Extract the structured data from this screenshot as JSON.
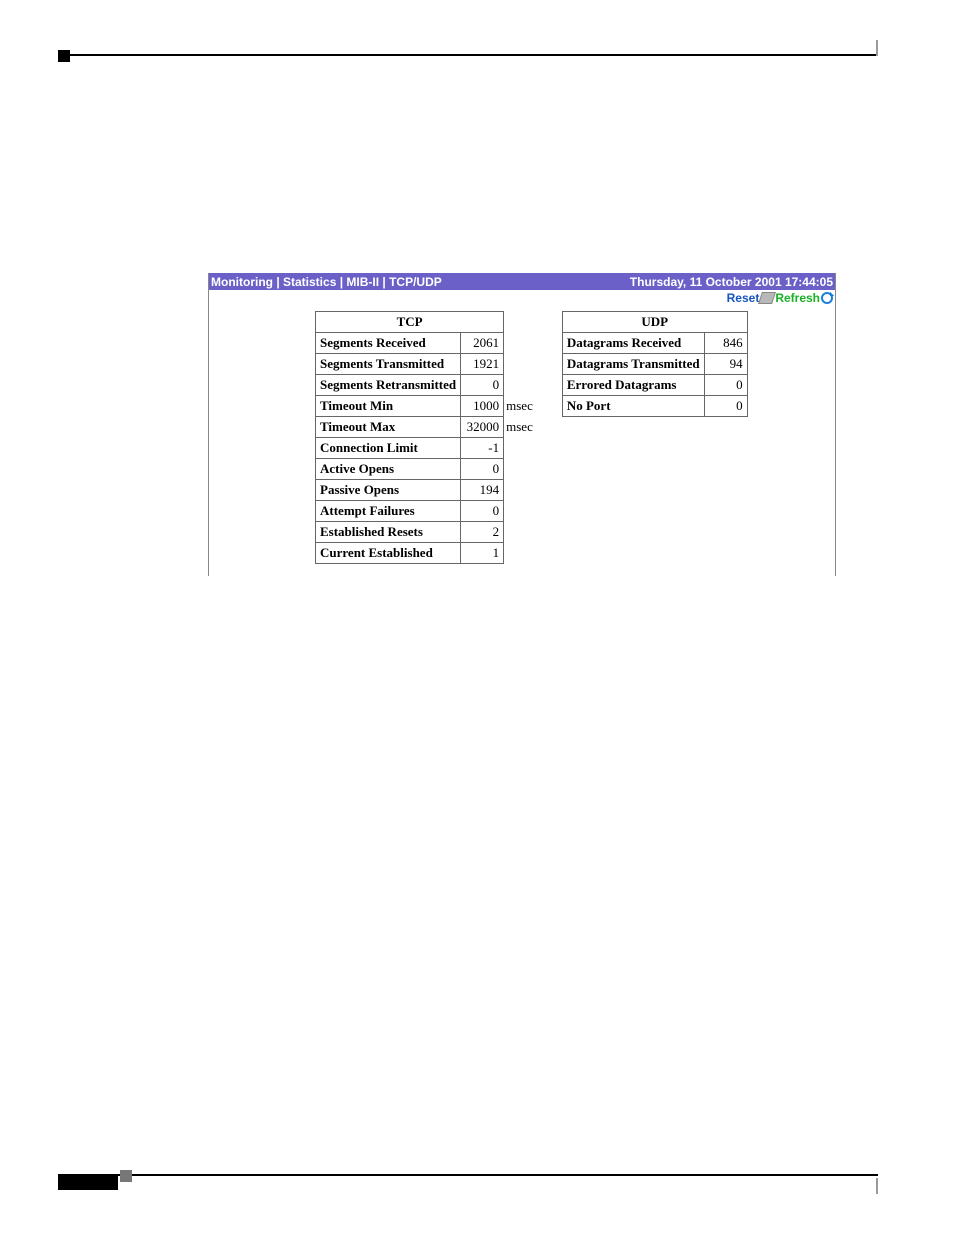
{
  "header": {
    "breadcrumb": "Monitoring | Statistics | MIB-II | TCP/UDP",
    "timestamp": "Thursday, 11 October 2001 17:44:05",
    "links": {
      "reset": "Reset",
      "refresh": "Refresh"
    }
  },
  "tcp": {
    "title": "TCP",
    "rows": [
      {
        "label": "Segments Received",
        "value": "2061",
        "unit": ""
      },
      {
        "label": "Segments Transmitted",
        "value": "1921",
        "unit": ""
      },
      {
        "label": "Segments Retransmitted",
        "value": "0",
        "unit": ""
      },
      {
        "label": "Timeout Min",
        "value": "1000",
        "unit": "msec"
      },
      {
        "label": "Timeout Max",
        "value": "32000",
        "unit": "msec"
      },
      {
        "label": "Connection Limit",
        "value": "-1",
        "unit": ""
      },
      {
        "label": "Active Opens",
        "value": "0",
        "unit": ""
      },
      {
        "label": "Passive Opens",
        "value": "194",
        "unit": ""
      },
      {
        "label": "Attempt Failures",
        "value": "0",
        "unit": ""
      },
      {
        "label": "Established Resets",
        "value": "2",
        "unit": ""
      },
      {
        "label": "Current Established",
        "value": "1",
        "unit": ""
      }
    ]
  },
  "udp": {
    "title": "UDP",
    "rows": [
      {
        "label": "Datagrams Received",
        "value": "846"
      },
      {
        "label": "Datagrams Transmitted",
        "value": "94"
      },
      {
        "label": "Errored Datagrams",
        "value": "0"
      },
      {
        "label": "No Port",
        "value": "0"
      }
    ]
  }
}
